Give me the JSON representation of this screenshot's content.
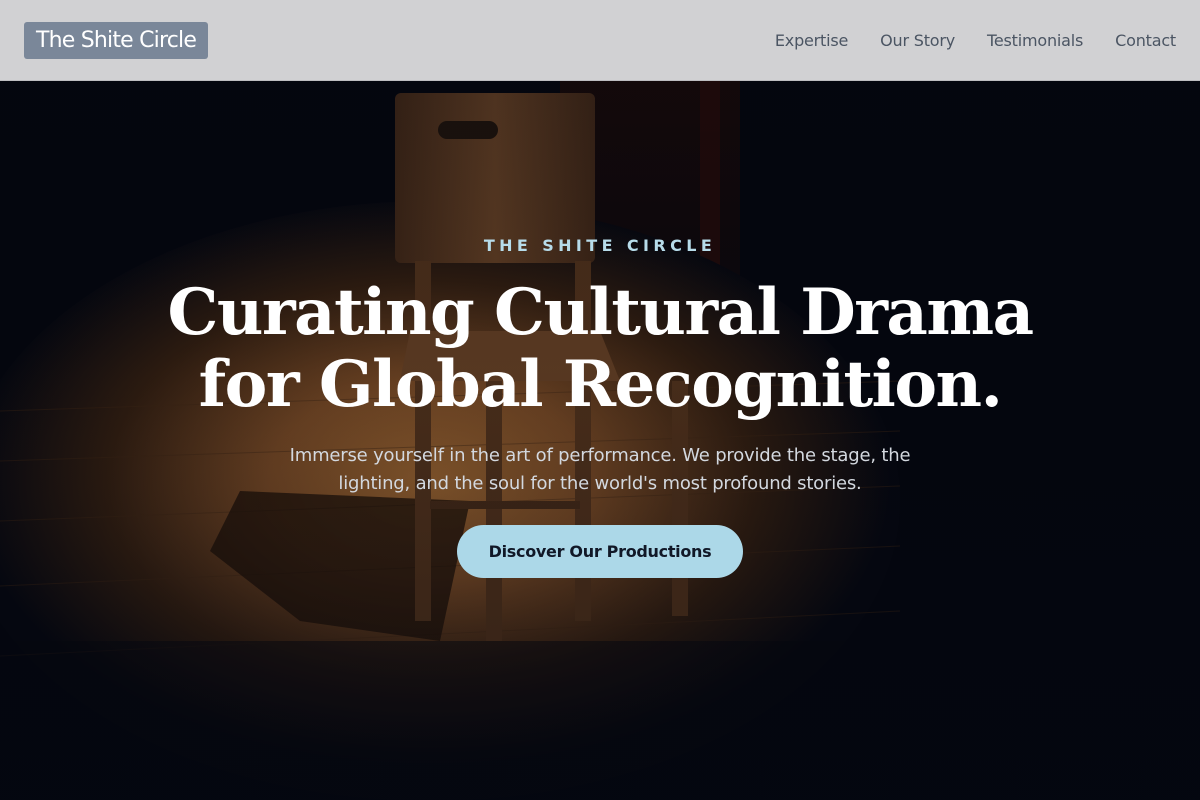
{
  "header": {
    "logo_text": "The Shite Circle",
    "nav": [
      {
        "label": "Expertise"
      },
      {
        "label": "Our Story"
      },
      {
        "label": "Testimonials"
      },
      {
        "label": "Contact"
      }
    ]
  },
  "hero": {
    "eyebrow": "THE SHITE CIRCLE",
    "headline_line1": "Curating Cultural Drama",
    "headline_line2": "for Global Recognition.",
    "subtext_line1": "Immerse yourself in the art of performance. We provide the stage, the",
    "subtext_line2": "lighting, and the soul for the world's most profound stories.",
    "cta_label": "Discover Our Productions",
    "background_image": "wooden-chair-spotlight-stage"
  },
  "colors": {
    "header_bg": "#d1d1d3",
    "logo_bg": "#7a8799",
    "nav_text": "#4b5563",
    "eyebrow": "#b7dcea",
    "cta_bg": "#acd8e8",
    "hero_dark": "#05070f"
  }
}
